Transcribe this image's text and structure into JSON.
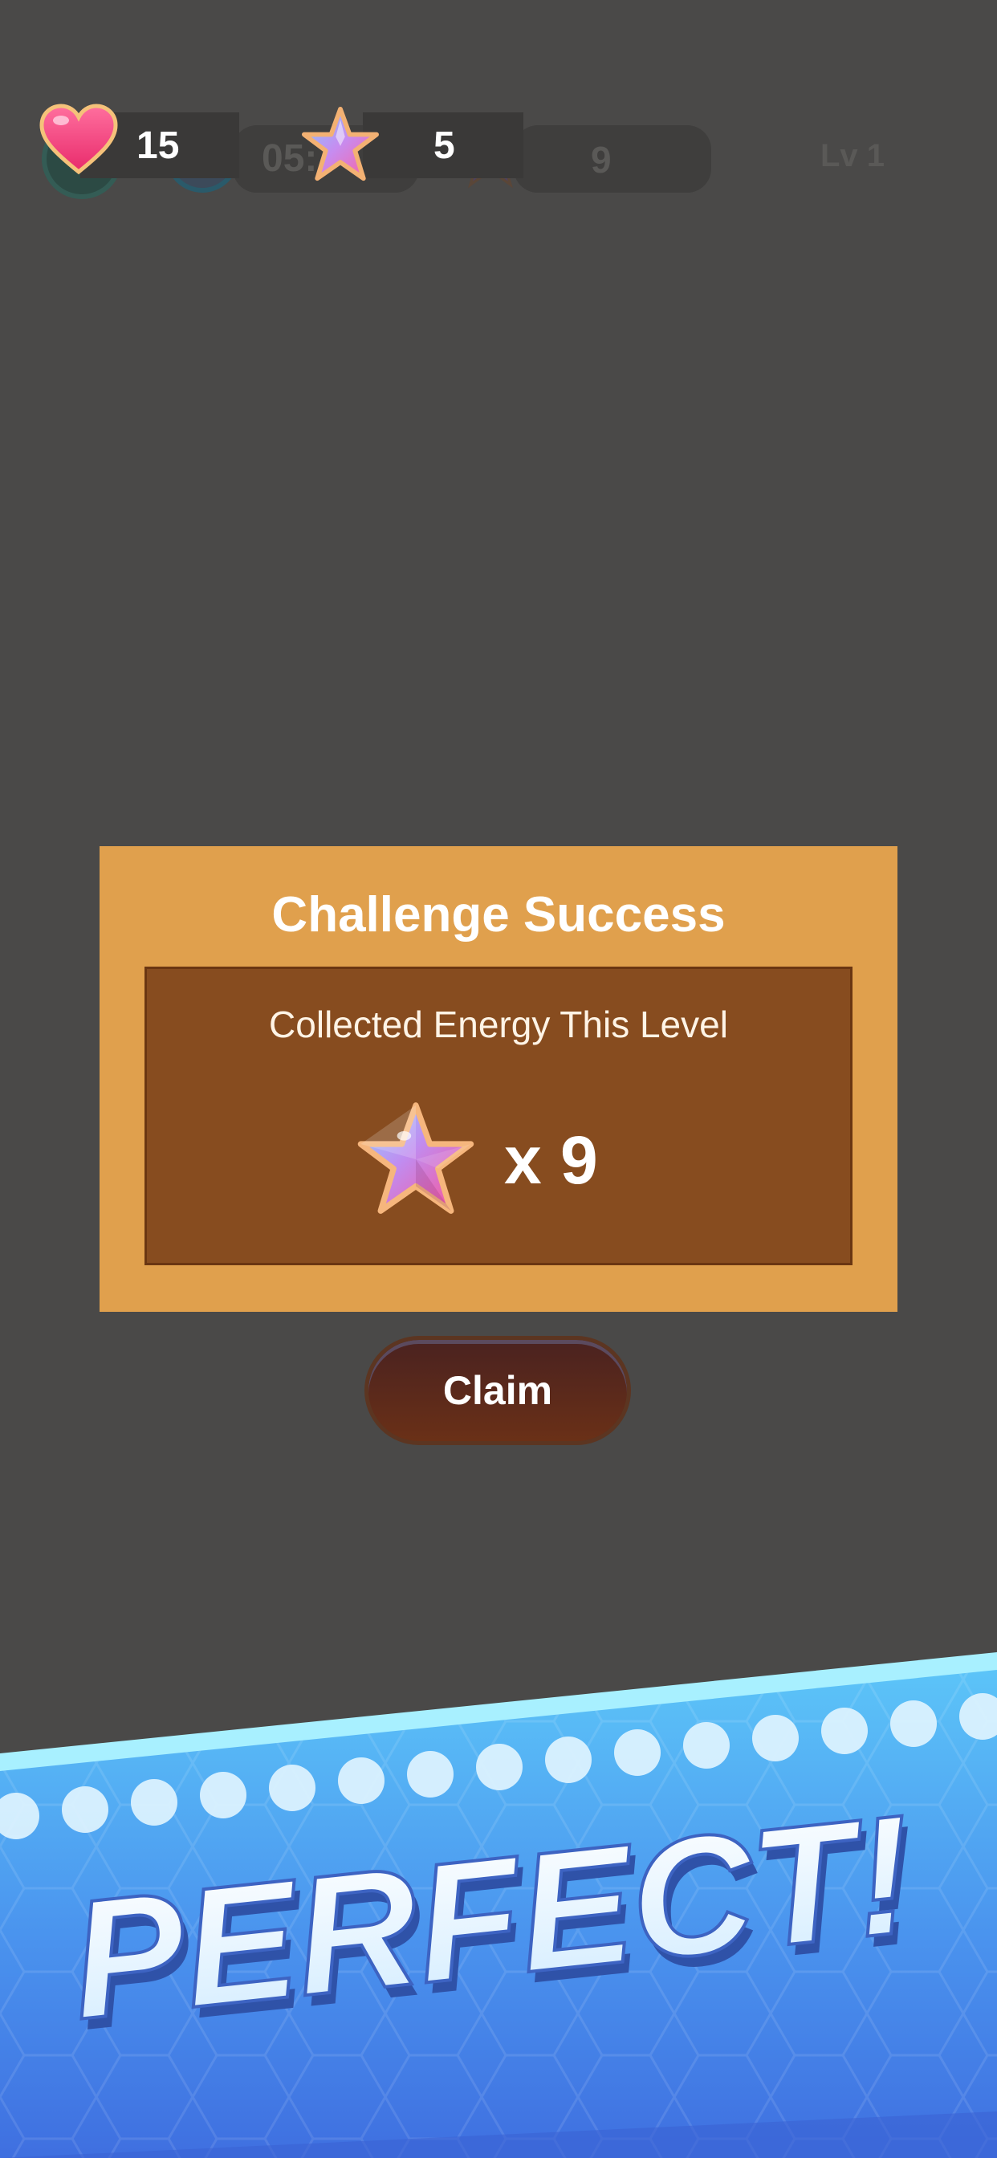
{
  "background_hud": {
    "timer_text": "05:",
    "energy_text": "9",
    "level_text": "Lv 1"
  },
  "hud": {
    "lives": "15",
    "stars": "5"
  },
  "dialog": {
    "title": "Challenge Success",
    "label": "Collected Energy This Level",
    "reward_count": "x 9"
  },
  "claim_button": {
    "label": "Claim"
  },
  "banner": {
    "text": "PERFECT!"
  },
  "colors": {
    "background": "#4a4948",
    "dialog_frame": "#e0a04d",
    "dialog_inner": "#874c1f",
    "claim_button": "#5a2a1c",
    "banner_blue": "#4a8ff0"
  },
  "icons": {
    "lives": "heart-icon",
    "stars": "star-icon",
    "reward": "star-icon"
  }
}
